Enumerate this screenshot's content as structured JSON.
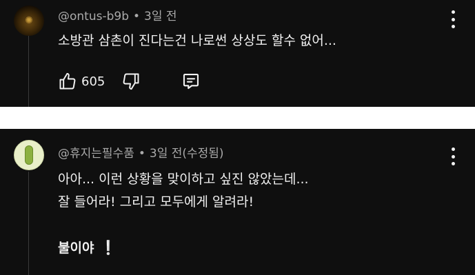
{
  "comments": [
    {
      "author": "@ontus-b9b",
      "time": "3일 전",
      "lines": [
        "소방관 삼촌이 진다는건 나로썬 상상도 할수 없어..."
      ],
      "likes": "605",
      "avatar_icon": "dark-gold-emblem"
    },
    {
      "author": "@휴지는필수품",
      "time": "3일 전(수정됨)",
      "lines": [
        "아아... 이런 상황을 맞이하고 싶진 않았는데...",
        "잘 들어라! 그리고 모두에게 알려라!"
      ],
      "final_line": "불이야",
      "final_mark": "❕",
      "avatar_icon": "green-pill-emblem"
    }
  ],
  "separator": "•",
  "icons": {
    "like": "thumbs-up-icon",
    "dislike": "thumbs-down-icon",
    "reply": "reply-bubble-icon",
    "more": "more-vert-icon"
  },
  "colors": {
    "background": "#0f0f0f",
    "text": "#f1f1f1",
    "meta": "#aaaaaa",
    "gap": "#ffffff"
  }
}
